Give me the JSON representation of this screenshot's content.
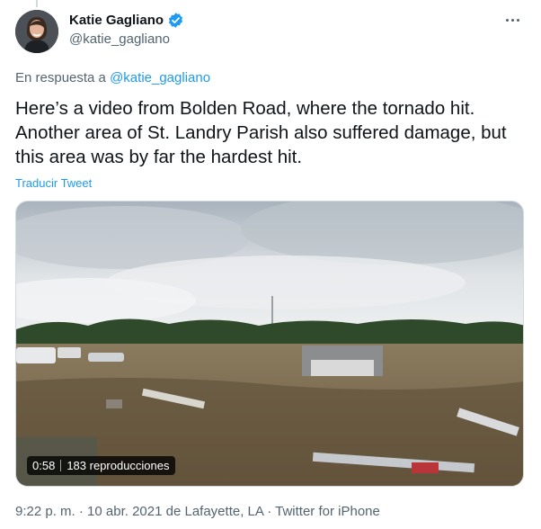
{
  "author": {
    "display_name": "Katie Gagliano",
    "handle": "@katie_gagliano",
    "verified": true
  },
  "more_icon": "more-horizontal-icon",
  "reply_context": {
    "prefix": "En respuesta a",
    "mention": "@katie_gagliano"
  },
  "tweet": {
    "text": "Here’s a video from Bolden Road, where the tornado hit. Another area of St. Landry Parish also suffered damage, but this area was by far the hardest hit.",
    "translate_label": "Traducir Tweet"
  },
  "video": {
    "duration": "0:58",
    "views": "183 reproducciones"
  },
  "meta": {
    "time": "9:22 p. m.",
    "date": "10 abr. 2021",
    "location": "de Lafayette, LA",
    "source": "Twitter for iPhone"
  },
  "colors": {
    "accent": "#1d9bf0",
    "secondary_text": "#536471",
    "primary_text": "#0f1419"
  }
}
